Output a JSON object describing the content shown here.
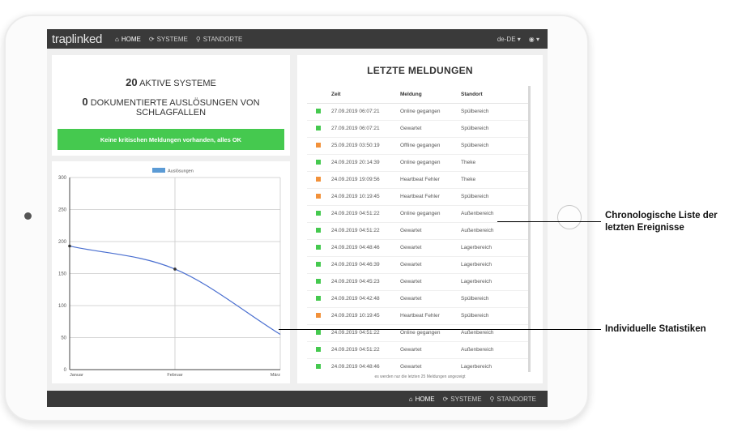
{
  "navbar": {
    "logo": "traplinked",
    "items": [
      {
        "label": "HOME",
        "icon": "home-icon"
      },
      {
        "label": "SYSTEME",
        "icon": "systems-icon"
      },
      {
        "label": "STANDORTE",
        "icon": "map-marker-icon"
      }
    ],
    "language": "de-DE ▾",
    "user": "◉ ▾"
  },
  "summary": {
    "active_count": "20",
    "active_label": "AKTIVE SYSTEME",
    "triggers_count": "0",
    "triggers_label": "DOKUMENTIERTE AUSLÖSUNGEN VON SCHLAGFALLEN",
    "status_message": "Keine kritischen Meldungen vorhanden, alles OK",
    "status_color": "#45c94f"
  },
  "events": {
    "title": "LETZTE MELDUNGEN",
    "columns": [
      "Zeit",
      "Meldung",
      "Standort"
    ],
    "colors": {
      "green": "#45c94f",
      "orange": "#f2913a"
    },
    "rows": [
      {
        "status": "green",
        "time": "27.09.2019 06:07:21",
        "message": "Online gegangen",
        "location": "Spülbereich"
      },
      {
        "status": "green",
        "time": "27.09.2019 06:07:21",
        "message": "Gewartet",
        "location": "Spülbereich"
      },
      {
        "status": "orange",
        "time": "25.09.2019 03:50:19",
        "message": "Offline gegangen",
        "location": "Spülbereich"
      },
      {
        "status": "green",
        "time": "24.09.2019 20:14:39",
        "message": "Online gegangen",
        "location": "Theke"
      },
      {
        "status": "orange",
        "time": "24.09.2019 19:09:56",
        "message": "Heartbeat Fehler",
        "location": "Theke"
      },
      {
        "status": "orange",
        "time": "24.09.2019 10:19:45",
        "message": "Heartbeat Fehler",
        "location": "Spülbereich"
      },
      {
        "status": "green",
        "time": "24.09.2019 04:51:22",
        "message": "Online gegangen",
        "location": "Außenbereich"
      },
      {
        "status": "green",
        "time": "24.09.2019 04:51:22",
        "message": "Gewartet",
        "location": "Außenbereich"
      },
      {
        "status": "green",
        "time": "24.09.2019 04:48:46",
        "message": "Gewartet",
        "location": "Lagerbereich"
      },
      {
        "status": "green",
        "time": "24.09.2019 04:46:39",
        "message": "Gewartet",
        "location": "Lagerbereich"
      },
      {
        "status": "green",
        "time": "24.09.2019 04:45:23",
        "message": "Gewartet",
        "location": "Lagerbereich"
      },
      {
        "status": "green",
        "time": "24.09.2019 04:42:48",
        "message": "Gewartet",
        "location": "Spülbereich"
      },
      {
        "status": "orange",
        "time": "24.09.2019 10:19:45",
        "message": "Heartbeat Fehler",
        "location": "Spülbereich"
      },
      {
        "status": "green",
        "time": "24.09.2019 04:51:22",
        "message": "Online gegangen",
        "location": "Außenbereich"
      },
      {
        "status": "green",
        "time": "24.09.2019 04:51:22",
        "message": "Gewartet",
        "location": "Außenbereich"
      },
      {
        "status": "green",
        "time": "24.09.2019 04:48:46",
        "message": "Gewartet",
        "location": "Lagerbereich"
      }
    ],
    "footnote": "es werden nur die letzten 25 Meldungen angezeigt"
  },
  "footer": {
    "items": [
      {
        "label": "HOME",
        "icon": "home-icon"
      },
      {
        "label": "SYSTEME",
        "icon": "systems-icon"
      },
      {
        "label": "STANDORTE",
        "icon": "map-marker-icon"
      }
    ]
  },
  "callouts": {
    "events_list": "Chronologische Liste der letzten Ereignisse",
    "statistics": "Individuelle Statistiken"
  },
  "chart_data": {
    "type": "line",
    "categories": [
      "Januar",
      "Februar",
      "März"
    ],
    "series": [
      {
        "name": "Auslösungen",
        "values": [
          193,
          157,
          55
        ],
        "color": "#4a6fd0"
      }
    ],
    "title": "",
    "xlabel": "",
    "ylabel": "",
    "ylim": [
      0,
      300
    ],
    "yticks": [
      0,
      50,
      100,
      150,
      200,
      250,
      300
    ],
    "grid": true,
    "legend": "top-center",
    "legend_color": "#5b9bd5"
  }
}
